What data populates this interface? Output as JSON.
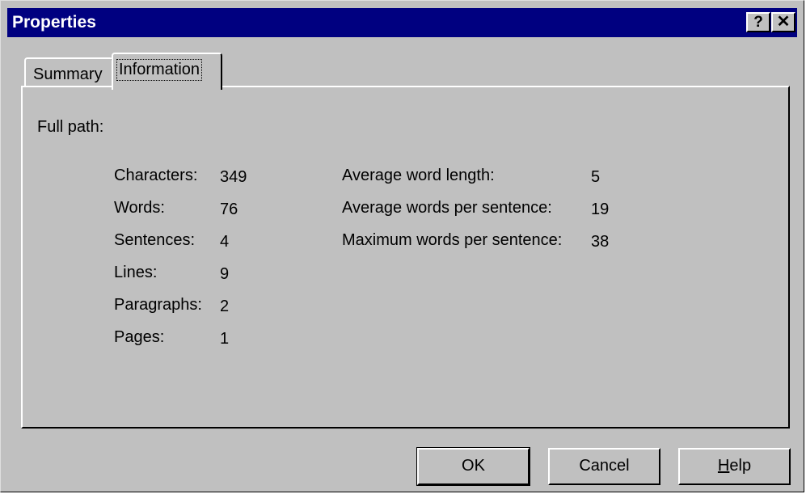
{
  "window": {
    "title": "Properties",
    "help_button": "?",
    "close_button": "✕"
  },
  "tabs": [
    {
      "label": "Summary",
      "active": false
    },
    {
      "label": "Information",
      "active": true
    }
  ],
  "info": {
    "full_path_label": "Full path:",
    "stats_left": [
      {
        "label": "Characters:",
        "value": "349"
      },
      {
        "label": "Words:",
        "value": "76"
      },
      {
        "label": "Sentences:",
        "value": "4"
      },
      {
        "label": "Lines:",
        "value": "9"
      },
      {
        "label": "Paragraphs:",
        "value": "2"
      },
      {
        "label": "Pages:",
        "value": "1"
      }
    ],
    "stats_right": [
      {
        "label": "Average word length:",
        "value": "5"
      },
      {
        "label": "Average words per sentence:",
        "value": "19"
      },
      {
        "label": "Maximum words per sentence:",
        "value": "38"
      }
    ]
  },
  "buttons": {
    "ok": "OK",
    "cancel": "Cancel",
    "help_mnemonic": "H",
    "help_rest": "elp"
  }
}
